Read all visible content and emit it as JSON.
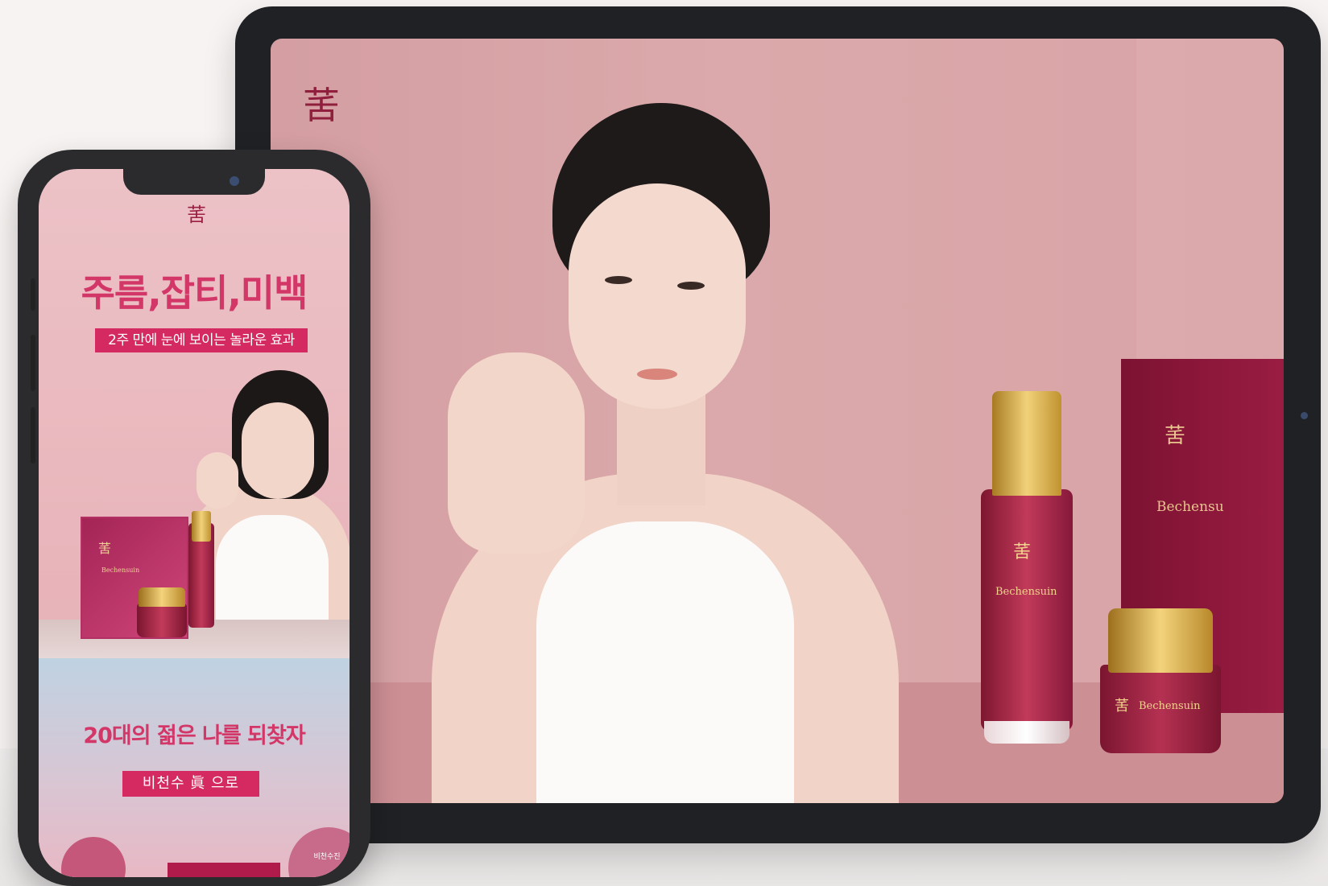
{
  "tablet": {
    "logo_glyph": "䒷",
    "products": {
      "box_brand": "Bechensu",
      "bottle_brand": "Bechensuin",
      "jar_brand": "Bechensuin",
      "logo_glyph": "䒷"
    }
  },
  "phone": {
    "logo_glyph": "䒷",
    "headline": "주름,잡티,미백",
    "subheadline": "2주 만에 눈에 보이는 놀라운 효과",
    "box_brand": "Bechensuin",
    "slogan": "20대의 젊은 나를 되찾자",
    "cta_label": "비천수 眞 으로",
    "circle_caption": "비천수진"
  },
  "colors": {
    "accent": "#d23768",
    "badge": "#d52a61",
    "tablet_bg": "#dba9ab",
    "product_red": "#9a1c43",
    "gold": "#f2d28d"
  }
}
